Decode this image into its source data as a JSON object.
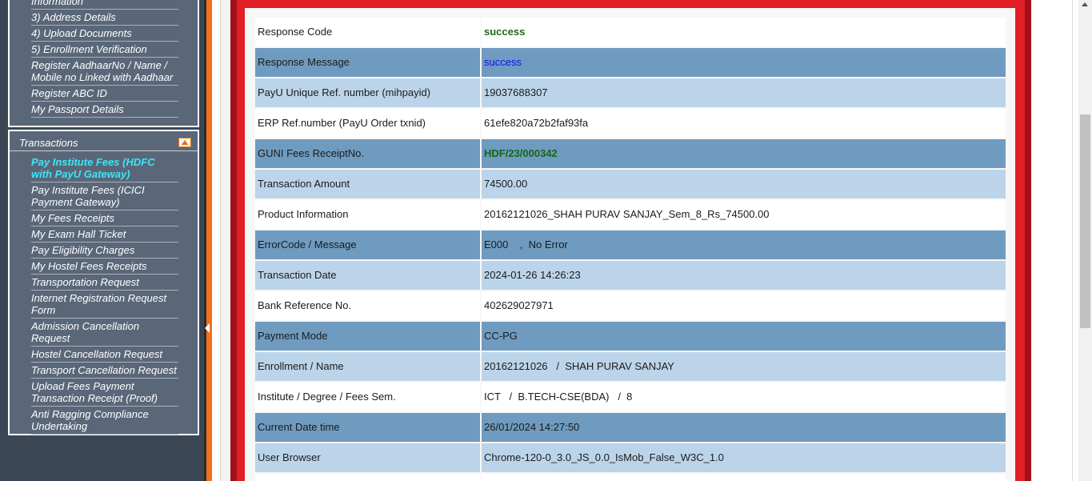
{
  "sidebar": {
    "top_menu": [
      {
        "label": "Information"
      },
      {
        "label": "3) Address Details"
      },
      {
        "label": "4) Upload Documents"
      },
      {
        "label": "5) Enrollment Verification"
      },
      {
        "label": "Register AadhaarNo / Name / Mobile no Linked with Aadhaar"
      },
      {
        "label": "Register ABC ID"
      },
      {
        "label": "My Passport Details"
      }
    ],
    "section_title": "Transactions",
    "section_icon": "collapse-up-icon",
    "transactions_menu": [
      {
        "label": "Pay Institute Fees (HDFC with PayU Gateway)",
        "active": true
      },
      {
        "label": "Pay Institute Fees (ICICI Payment Gateway)"
      },
      {
        "label": "My Fees Receipts"
      },
      {
        "label": "My Exam Hall Ticket"
      },
      {
        "label": "Pay Eligibility Charges"
      },
      {
        "label": "My Hostel Fees Receipts"
      },
      {
        "label": "Transportation Request"
      },
      {
        "label": "Internet Registration Request Form"
      },
      {
        "label": "Admission Cancellation Request"
      },
      {
        "label": "Hostel Cancellation Request"
      },
      {
        "label": "Transport Cancellation Request"
      },
      {
        "label": "Upload Fees Payment Transaction Receipt (Proof)"
      },
      {
        "label": "Anti Ragging Compliance Undertaking"
      }
    ]
  },
  "transaction_details": [
    {
      "label": "Response Code",
      "value": "success",
      "style": "white",
      "value_style": "green"
    },
    {
      "label": "Response Message",
      "value": "success",
      "style": "dark",
      "value_style": "blue"
    },
    {
      "label": "PayU Unique Ref. number (mihpayid)",
      "value": "19037688307",
      "style": "light"
    },
    {
      "label": "ERP Ref.number (PayU Order txnid)",
      "value": "61efe820a72b2faf93fa",
      "style": "white"
    },
    {
      "label": "GUNI Fees ReceiptNo.",
      "value": "HDF/23/000342",
      "style": "dark",
      "value_style": "green-bold"
    },
    {
      "label": "Transaction Amount",
      "value": "74500.00",
      "style": "light"
    },
    {
      "label": "Product Information",
      "value": "20162121026_SHAH PURAV SANJAY_Sem_8_Rs_74500.00",
      "style": "white"
    },
    {
      "label": "ErrorCode / Message",
      "value": "E000    ,  No Error",
      "style": "dark"
    },
    {
      "label": "Transaction Date",
      "value": "2024-01-26 14:26:23",
      "style": "light"
    },
    {
      "label": "Bank Reference No.",
      "value": "402629027971",
      "style": "white"
    },
    {
      "label": "Payment Mode",
      "value": "CC-PG",
      "style": "dark"
    },
    {
      "label": "Enrollment / Name",
      "value": "20162121026   /  SHAH PURAV SANJAY",
      "style": "light"
    },
    {
      "label": "Institute / Degree / Fees Sem.",
      "value": "ICT   /  B.TECH-CSE(BDA)   /  8",
      "style": "white"
    },
    {
      "label": "Current Date time",
      "value": "26/01/2024 14:27:50",
      "style": "dark"
    },
    {
      "label": "User Browser",
      "value": "Chrome-120-0_3.0_JS_0.0_IsMob_False_W3C_1.0",
      "style": "light"
    },
    {
      "label": "",
      "value": "",
      "style": "white"
    }
  ],
  "colors": {
    "sidebar_bg": "#3a4654",
    "menu_bg": "#5a6779",
    "active_link": "#3ee6f6",
    "splitter": "#f2711c",
    "frame_red": "#e31e25",
    "row_dark": "#6f9bc0",
    "row_light": "#bcd4ea",
    "success_green": "#1d6b1d",
    "message_blue": "#1010ee"
  }
}
